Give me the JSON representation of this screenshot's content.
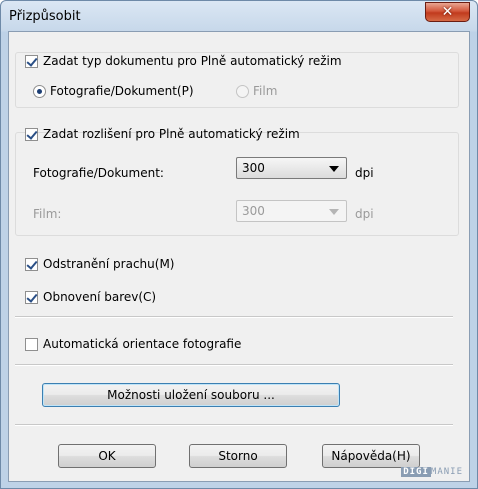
{
  "window": {
    "title": "Přizpůsobit",
    "close_glyph": "✕"
  },
  "group1": {
    "checkbox_label": "Zadat typ dokumentu pro Plně automatický režim",
    "checked": true,
    "radio_photo_label": "Fotografie/Dokument(P)",
    "radio_film_label": "Film",
    "selected": "photo"
  },
  "group2": {
    "checkbox_label": "Zadat rozlišení pro Plně automatický režim",
    "checked": true,
    "photo_label": "Fotografie/Dokument:",
    "photo_value": "300",
    "photo_unit": "dpi",
    "film_label": "Film:",
    "film_value": "300",
    "film_unit": "dpi"
  },
  "options": {
    "dust_label": "Odstranění prachu(M)",
    "dust_checked": true,
    "color_label": "Obnovení barev(C)",
    "color_checked": true,
    "orient_label": "Automatická orientace fotografie",
    "orient_checked": false
  },
  "save_options_button": "Možnosti uložení souboru ...",
  "buttons": {
    "ok": "OK",
    "cancel": "Storno",
    "help": "Nápověda(H)"
  },
  "watermark": {
    "left": "DIGI",
    "right": "MANIE"
  },
  "icons": [
    "close-icon",
    "checkbox-check-icon",
    "radio-dot-icon",
    "dropdown-arrow-icon"
  ]
}
